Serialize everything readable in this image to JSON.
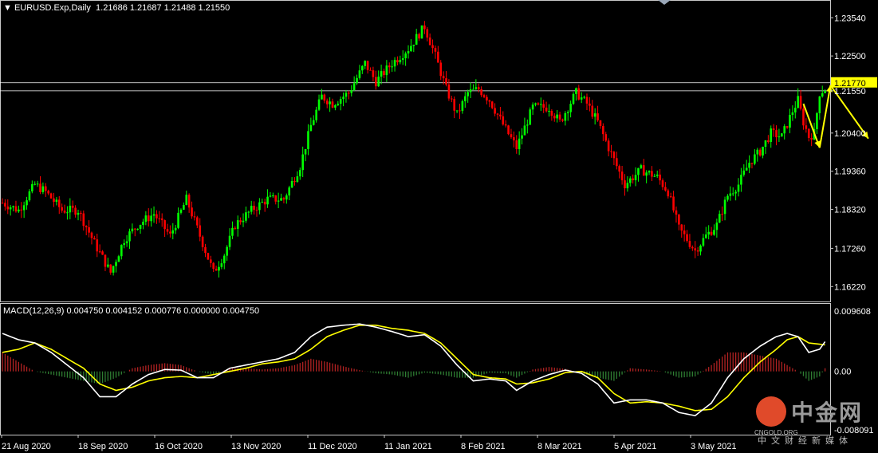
{
  "header": {
    "symbol": "EURUSD.Exp,Daily",
    "ohlc": "1.21686 1.21687 1.21488 1.21550"
  },
  "macd_header": "MACD(12,26,9) 0.004750 0.004152 0.000776 0.000000 0.004750",
  "logo": {
    "name": "中金网",
    "domain": "CNGOLD.ORG",
    "slogan": "中文财经新媒体"
  },
  "colors": {
    "bull": "#00ff00",
    "bear": "#ff0000",
    "macd_line": "#ffffff",
    "signal_line": "#ffff00",
    "hist_pos": "#b22222",
    "hist_neg": "#2e7d32",
    "arrow": "#ffff00",
    "price_tag": "#ffff00",
    "grid": "#ffffff"
  },
  "chart_data": [
    {
      "type": "candlestick",
      "ylim": [
        1.159,
        1.2385
      ],
      "y_ticks": [
        "1.23540",
        "1.22500",
        "1.21550",
        "1.20400",
        "1.19360",
        "1.18320",
        "1.17260",
        "1.16220"
      ],
      "x_ticks": [
        "21 Aug 2020",
        "18 Sep 2020",
        "16 Oct 2020",
        "13 Nov 2020",
        "11 Dec 2020",
        "11 Jan 2021",
        "8 Feb 2021",
        "8 Mar 2021",
        "5 Apr 2021",
        "3 May 2021"
      ],
      "horizontal_lines": [
        1.2177,
        1.2155
      ],
      "price_labels": [
        {
          "text": "1.21770",
          "value": 1.2177
        },
        {
          "text": "1.21550",
          "value": 1.2155
        }
      ],
      "close_path": [
        {
          "i": 0,
          "c": 1.185
        },
        {
          "i": 6,
          "c": 1.183
        },
        {
          "i": 12,
          "c": 1.19
        },
        {
          "i": 16,
          "c": 1.188
        },
        {
          "i": 22,
          "c": 1.183
        },
        {
          "i": 28,
          "c": 1.183
        },
        {
          "i": 34,
          "c": 1.174
        },
        {
          "i": 40,
          "c": 1.166
        },
        {
          "i": 45,
          "c": 1.175
        },
        {
          "i": 50,
          "c": 1.179
        },
        {
          "i": 56,
          "c": 1.182
        },
        {
          "i": 62,
          "c": 1.176
        },
        {
          "i": 68,
          "c": 1.186
        },
        {
          "i": 74,
          "c": 1.174
        },
        {
          "i": 78,
          "c": 1.166
        },
        {
          "i": 82,
          "c": 1.171
        },
        {
          "i": 86,
          "c": 1.179
        },
        {
          "i": 92,
          "c": 1.183
        },
        {
          "i": 98,
          "c": 1.186
        },
        {
          "i": 104,
          "c": 1.186
        },
        {
          "i": 110,
          "c": 1.195
        },
        {
          "i": 114,
          "c": 1.206
        },
        {
          "i": 118,
          "c": 1.214
        },
        {
          "i": 122,
          "c": 1.212
        },
        {
          "i": 128,
          "c": 1.215
        },
        {
          "i": 134,
          "c": 1.223
        },
        {
          "i": 138,
          "c": 1.218
        },
        {
          "i": 144,
          "c": 1.223
        },
        {
          "i": 150,
          "c": 1.227
        },
        {
          "i": 156,
          "c": 1.233
        },
        {
          "i": 160,
          "c": 1.225
        },
        {
          "i": 164,
          "c": 1.216
        },
        {
          "i": 168,
          "c": 1.209
        },
        {
          "i": 172,
          "c": 1.215
        },
        {
          "i": 176,
          "c": 1.216
        },
        {
          "i": 180,
          "c": 1.213
        },
        {
          "i": 186,
          "c": 1.205
        },
        {
          "i": 190,
          "c": 1.2
        },
        {
          "i": 196,
          "c": 1.211
        },
        {
          "i": 202,
          "c": 1.211
        },
        {
          "i": 206,
          "c": 1.207
        },
        {
          "i": 212,
          "c": 1.215
        },
        {
          "i": 216,
          "c": 1.212
        },
        {
          "i": 220,
          "c": 1.207
        },
        {
          "i": 224,
          "c": 1.2
        },
        {
          "i": 230,
          "c": 1.19
        },
        {
          "i": 236,
          "c": 1.194
        },
        {
          "i": 242,
          "c": 1.192
        },
        {
          "i": 246,
          "c": 1.188
        },
        {
          "i": 250,
          "c": 1.178
        },
        {
          "i": 254,
          "c": 1.174
        },
        {
          "i": 256,
          "c": 1.172
        },
        {
          "i": 260,
          "c": 1.176
        },
        {
          "i": 264,
          "c": 1.179
        },
        {
          "i": 268,
          "c": 1.187
        },
        {
          "i": 272,
          "c": 1.19
        },
        {
          "i": 276,
          "c": 1.196
        },
        {
          "i": 280,
          "c": 1.199
        },
        {
          "i": 284,
          "c": 1.204
        },
        {
          "i": 288,
          "c": 1.203
        },
        {
          "i": 292,
          "c": 1.21
        },
        {
          "i": 294,
          "c": 1.213
        },
        {
          "i": 296,
          "c": 1.207
        },
        {
          "i": 298,
          "c": 1.203
        },
        {
          "i": 300,
          "c": 1.204
        },
        {
          "i": 302,
          "c": 1.215
        },
        {
          "i": 304,
          "c": 1.216
        }
      ],
      "annotations": [
        {
          "type": "arrow",
          "from": [
            296,
            1.212
          ],
          "to": [
            302,
            1.2
          ]
        },
        {
          "type": "arrow",
          "from": [
            302,
            1.2
          ],
          "to": [
            306,
            1.217
          ]
        },
        {
          "type": "arrow",
          "from": [
            306,
            1.217
          ],
          "to": [
            320,
            1.2025
          ]
        }
      ]
    },
    {
      "type": "macd",
      "ylim": [
        -0.0095,
        0.0103
      ],
      "y_ticks": [
        "0.009608",
        "0.00",
        "-0.008091"
      ],
      "macd_path": [
        {
          "i": 0,
          "v": 0.006
        },
        {
          "i": 6,
          "v": 0.005
        },
        {
          "i": 12,
          "v": 0.0045
        },
        {
          "i": 18,
          "v": 0.003
        },
        {
          "i": 24,
          "v": 0.001
        },
        {
          "i": 30,
          "v": -0.001
        },
        {
          "i": 36,
          "v": -0.004
        },
        {
          "i": 42,
          "v": -0.004
        },
        {
          "i": 48,
          "v": -0.002
        },
        {
          "i": 54,
          "v": -0.0005
        },
        {
          "i": 60,
          "v": 0.0003
        },
        {
          "i": 66,
          "v": 0.0002
        },
        {
          "i": 72,
          "v": -0.001
        },
        {
          "i": 78,
          "v": -0.001
        },
        {
          "i": 84,
          "v": 0.0005
        },
        {
          "i": 90,
          "v": 0.001
        },
        {
          "i": 96,
          "v": 0.0015
        },
        {
          "i": 102,
          "v": 0.002
        },
        {
          "i": 108,
          "v": 0.003
        },
        {
          "i": 114,
          "v": 0.0055
        },
        {
          "i": 120,
          "v": 0.007
        },
        {
          "i": 126,
          "v": 0.0073
        },
        {
          "i": 132,
          "v": 0.0075
        },
        {
          "i": 138,
          "v": 0.007
        },
        {
          "i": 144,
          "v": 0.0063
        },
        {
          "i": 150,
          "v": 0.0055
        },
        {
          "i": 156,
          "v": 0.0058
        },
        {
          "i": 162,
          "v": 0.004
        },
        {
          "i": 168,
          "v": 0.001
        },
        {
          "i": 174,
          "v": -0.0015
        },
        {
          "i": 180,
          "v": -0.0012
        },
        {
          "i": 186,
          "v": -0.0015
        },
        {
          "i": 190,
          "v": -0.003
        },
        {
          "i": 196,
          "v": -0.0015
        },
        {
          "i": 202,
          "v": -0.0005
        },
        {
          "i": 208,
          "v": 0.0002
        },
        {
          "i": 214,
          "v": -0.0003
        },
        {
          "i": 220,
          "v": -0.002
        },
        {
          "i": 226,
          "v": -0.005
        },
        {
          "i": 232,
          "v": -0.0045
        },
        {
          "i": 238,
          "v": -0.0045
        },
        {
          "i": 244,
          "v": -0.005
        },
        {
          "i": 250,
          "v": -0.0065
        },
        {
          "i": 256,
          "v": -0.007
        },
        {
          "i": 262,
          "v": -0.005
        },
        {
          "i": 268,
          "v": -0.001
        },
        {
          "i": 274,
          "v": 0.002
        },
        {
          "i": 280,
          "v": 0.004
        },
        {
          "i": 286,
          "v": 0.0055
        },
        {
          "i": 290,
          "v": 0.006
        },
        {
          "i": 294,
          "v": 0.0055
        },
        {
          "i": 298,
          "v": 0.003
        },
        {
          "i": 302,
          "v": 0.0035
        },
        {
          "i": 304,
          "v": 0.0047
        }
      ],
      "signal_path": [
        {
          "i": 0,
          "v": 0.003
        },
        {
          "i": 6,
          "v": 0.0035
        },
        {
          "i": 12,
          "v": 0.0045
        },
        {
          "i": 18,
          "v": 0.0035
        },
        {
          "i": 24,
          "v": 0.002
        },
        {
          "i": 30,
          "v": 0.0005
        },
        {
          "i": 36,
          "v": -0.002
        },
        {
          "i": 42,
          "v": -0.003
        },
        {
          "i": 48,
          "v": -0.0025
        },
        {
          "i": 54,
          "v": -0.0015
        },
        {
          "i": 60,
          "v": -0.001
        },
        {
          "i": 66,
          "v": -0.0008
        },
        {
          "i": 72,
          "v": -0.001
        },
        {
          "i": 78,
          "v": -0.0005
        },
        {
          "i": 84,
          "v": 0.0
        },
        {
          "i": 90,
          "v": 0.0005
        },
        {
          "i": 96,
          "v": 0.0012
        },
        {
          "i": 102,
          "v": 0.0015
        },
        {
          "i": 108,
          "v": 0.002
        },
        {
          "i": 114,
          "v": 0.0035
        },
        {
          "i": 120,
          "v": 0.0055
        },
        {
          "i": 126,
          "v": 0.0065
        },
        {
          "i": 132,
          "v": 0.0073
        },
        {
          "i": 138,
          "v": 0.0073
        },
        {
          "i": 144,
          "v": 0.0068
        },
        {
          "i": 150,
          "v": 0.0065
        },
        {
          "i": 156,
          "v": 0.006
        },
        {
          "i": 162,
          "v": 0.0045
        },
        {
          "i": 168,
          "v": 0.002
        },
        {
          "i": 174,
          "v": -0.0005
        },
        {
          "i": 180,
          "v": -0.001
        },
        {
          "i": 186,
          "v": -0.0012
        },
        {
          "i": 190,
          "v": -0.002
        },
        {
          "i": 196,
          "v": -0.0018
        },
        {
          "i": 202,
          "v": -0.0012
        },
        {
          "i": 208,
          "v": -0.0002
        },
        {
          "i": 214,
          "v": 0.0
        },
        {
          "i": 220,
          "v": -0.001
        },
        {
          "i": 226,
          "v": -0.0035
        },
        {
          "i": 232,
          "v": -0.005
        },
        {
          "i": 238,
          "v": -0.0048
        },
        {
          "i": 244,
          "v": -0.005
        },
        {
          "i": 250,
          "v": -0.0055
        },
        {
          "i": 256,
          "v": -0.0062
        },
        {
          "i": 262,
          "v": -0.006
        },
        {
          "i": 268,
          "v": -0.004
        },
        {
          "i": 274,
          "v": -0.001
        },
        {
          "i": 280,
          "v": 0.0015
        },
        {
          "i": 286,
          "v": 0.0035
        },
        {
          "i": 290,
          "v": 0.005
        },
        {
          "i": 294,
          "v": 0.0055
        },
        {
          "i": 298,
          "v": 0.0045
        },
        {
          "i": 302,
          "v": 0.0043
        },
        {
          "i": 304,
          "v": 0.0042
        }
      ]
    }
  ]
}
